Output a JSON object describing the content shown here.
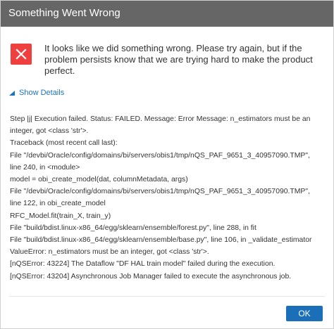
{
  "dialog": {
    "title": "Something Went Wrong",
    "message": "It looks like we did something wrong. Please try again, but if the problem persists know that we are trying hard to make the product perfect.",
    "details_toggle_label": "Show Details",
    "details_lines": [
      "Step |j| Execution failed. Status: FAILED. Message: Error Message: n_estimators must be an",
      "integer, got <class 'str'>.",
      "Traceback (most recent call last):",
      "File \"/devbi/Oracle/config/domains/bi/servers/obis1/tmp/nQS_PAF_9651_3_40957090.TMP\",",
      "line 240, in <module>",
      "model = obi_create_model(dat, columnMetadata, args)",
      "File \"/devbi/Oracle/config/domains/bi/servers/obis1/tmp/nQS_PAF_9651_3_40957090.TMP\",",
      "line 122, in obi_create_model",
      "RFC_Model.fit(train_X, train_y)",
      "File \"build/bdist.linux-x86_64/egg/sklearn/ensemble/forest.py\", line 288, in fit",
      "File \"build/bdist.linux-x86_64/egg/sklearn/ensemble/base.py\", line 106, in _validate_estimator",
      "ValueError: n_estimators must be an integer, got <class 'str'>.",
      "[nQSError: 43224] The Dataflow \"DF HAL train model\" failed during the execution.",
      "[nQSError: 43204] Asynchronous Job Manager failed to execute the asynchronous job."
    ],
    "ok_label": "OK"
  },
  "icons": {
    "error": "close-x-icon",
    "toggle": "triangle-expand-icon"
  },
  "colors": {
    "titlebar": "#666666",
    "error_icon": "#ef3f3f",
    "link": "#1a73c0",
    "primary_button": "#1a6fb8"
  }
}
